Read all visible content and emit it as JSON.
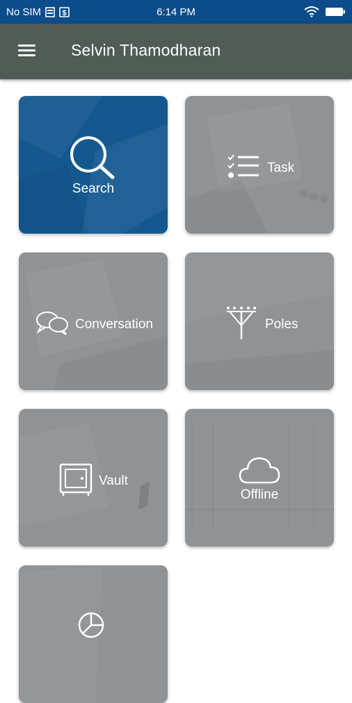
{
  "status": {
    "carrier": "No SIM",
    "time": "6:14 PM"
  },
  "header": {
    "title": "Selvin Thamodharan",
    "menu_icon": "hamburger-menu-icon"
  },
  "tiles": [
    {
      "label": "Search",
      "icon": "search-icon",
      "color": "#15588f"
    },
    {
      "label": "Task",
      "icon": "checklist-icon",
      "color": "#8f9396"
    },
    {
      "label": "Conversation",
      "icon": "chat-bubbles-icon",
      "color": "#8f9396"
    },
    {
      "label": "Poles",
      "icon": "utility-pole-icon",
      "color": "#8f9396"
    },
    {
      "label": "Vault",
      "icon": "safe-icon",
      "color": "#8f9396"
    },
    {
      "label": "Offline",
      "icon": "cloud-icon",
      "color": "#8f9396"
    },
    {
      "label": "",
      "icon": "pie-chart-icon",
      "color": "#8f9396"
    }
  ],
  "colors": {
    "statusbar": "#0d4c8a",
    "appbar": "#505c55",
    "tile_gray": "#8f9396",
    "tile_blue": "#15588f"
  }
}
